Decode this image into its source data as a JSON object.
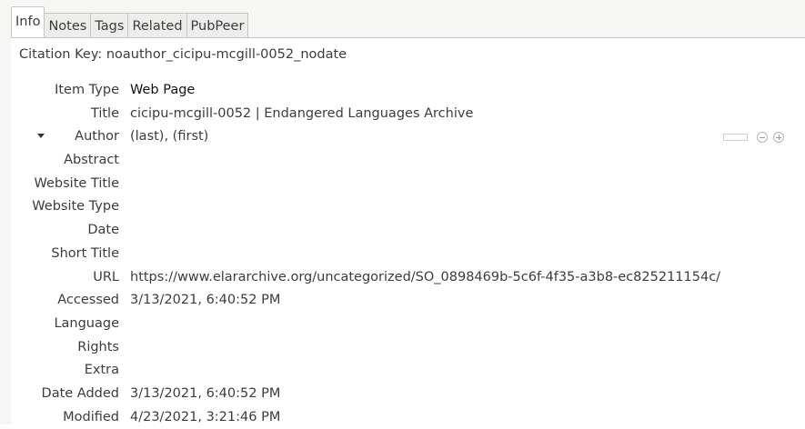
{
  "tabs": [
    "Info",
    "Notes",
    "Tags",
    "Related",
    "PubPeer"
  ],
  "citation_key": "Citation Key: noauthor_cicipu-mcgill-0052_nodate",
  "fields": {
    "item_type": {
      "label": "Item Type",
      "value": "Web Page"
    },
    "title": {
      "label": "Title",
      "value": "cicipu-mcgill-0052 | Endangered Languages Archive"
    },
    "author": {
      "label": "Author",
      "value": "(last), (first)"
    },
    "abstract": {
      "label": "Abstract",
      "value": ""
    },
    "website_title": {
      "label": "Website Title",
      "value": ""
    },
    "website_type": {
      "label": "Website Type",
      "value": ""
    },
    "date": {
      "label": "Date",
      "value": ""
    },
    "short_title": {
      "label": "Short Title",
      "value": ""
    },
    "url": {
      "label": "URL",
      "value": "https://www.elararchive.org/uncategorized/SO_0898469b-5c6f-4f35-a3b8-ec825211154c/"
    },
    "accessed": {
      "label": "Accessed",
      "value": "3/13/2021, 6:40:52 PM"
    },
    "language": {
      "label": "Language",
      "value": ""
    },
    "rights": {
      "label": "Rights",
      "value": ""
    },
    "extra": {
      "label": "Extra",
      "value": ""
    },
    "date_added": {
      "label": "Date Added",
      "value": "3/13/2021, 6:40:52 PM"
    },
    "modified": {
      "label": "Modified",
      "value": "4/23/2021, 3:21:46 PM"
    }
  },
  "icons": {
    "author_twisty": "chevron-down-icon",
    "creator_switch": "switch-field-mode-icon",
    "remove": "minus-circle-icon",
    "add": "plus-circle-icon"
  }
}
